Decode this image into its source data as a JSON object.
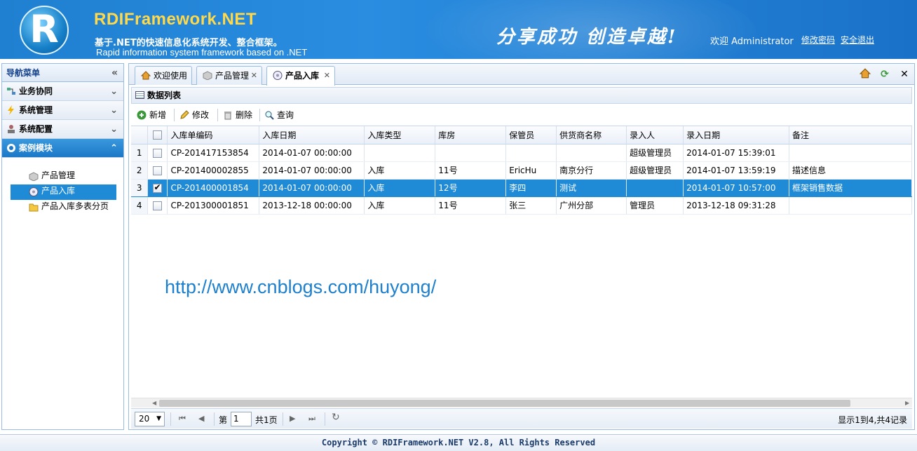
{
  "header": {
    "logo_letter": "R",
    "title": "RDIFramework.NET",
    "subtitle_cn": "基于.NET的快速信息化系统开发、整合框架。",
    "subtitle_en": "Rapid information system framework based on .NET",
    "slogan": "分享成功  创造卓越!",
    "welcome": "欢迎 Administrator",
    "change_password": "修改密码",
    "logout": "安全退出"
  },
  "sidebar": {
    "title": "导航菜单",
    "sections": [
      {
        "label": "业务协同",
        "icon": "workflow-icon"
      },
      {
        "label": "系统管理",
        "icon": "lightning-icon"
      },
      {
        "label": "系统配置",
        "icon": "user-config-icon"
      },
      {
        "label": "案例模块",
        "icon": "gear-icon"
      }
    ],
    "items": [
      {
        "label": "产品管理",
        "icon": "box-icon"
      },
      {
        "label": "产品入库",
        "icon": "disk-icon"
      },
      {
        "label": "产品入库多表分页",
        "icon": "folder-icon"
      }
    ]
  },
  "tabs": [
    {
      "label": "欢迎使用",
      "icon": "home-icon"
    },
    {
      "label": "产品管理",
      "icon": "box-icon"
    },
    {
      "label": "产品入库",
      "icon": "disk-icon"
    }
  ],
  "panel": {
    "title": "数据列表"
  },
  "toolbar": {
    "add": "新增",
    "edit": "修改",
    "delete": "删除",
    "query": "查询"
  },
  "grid": {
    "columns": [
      "入库单编码",
      "入库日期",
      "入库类型",
      "库房",
      "保管员",
      "供货商名称",
      "录入人",
      "录入日期",
      "备注"
    ],
    "rows": [
      {
        "num": "1",
        "checked": false,
        "cells": [
          "CP-201417153854",
          "2014-01-07 00:00:00",
          "",
          "",
          "",
          "",
          "超级管理员",
          "2014-01-07 15:39:01",
          ""
        ]
      },
      {
        "num": "2",
        "checked": false,
        "cells": [
          "CP-201400002855",
          "2014-01-07 00:00:00",
          "入库",
          "11号",
          "EricHu",
          "南京分行",
          "超级管理员",
          "2014-01-07 13:59:19",
          "描述信息"
        ]
      },
      {
        "num": "3",
        "checked": true,
        "cells": [
          "CP-201400001854",
          "2014-01-07 00:00:00",
          "入库",
          "12号",
          "李四",
          "测试",
          "",
          "2014-01-07 10:57:00",
          "框架销售数据"
        ]
      },
      {
        "num": "4",
        "checked": false,
        "cells": [
          "CP-201300001851",
          "2013-12-18 00:00:00",
          "入库",
          "11号",
          "张三",
          "广州分部",
          "管理员",
          "2013-12-18 09:31:28",
          ""
        ]
      }
    ]
  },
  "pager": {
    "page_size": "20",
    "page_label": "第",
    "page_value": "1",
    "total_pages": "共1页",
    "info": "显示1到4,共4记录"
  },
  "watermark": "http://www.cnblogs.com/huyong/",
  "footer": "Copyright © RDIFramework.NET V2.8, All Rights Reserved"
}
